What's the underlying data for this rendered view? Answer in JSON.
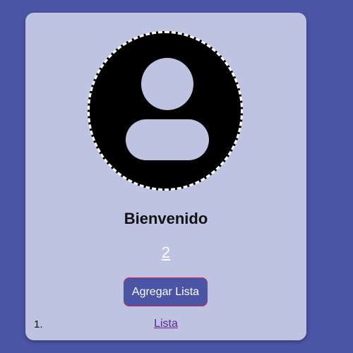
{
  "header": {
    "welcome": "Bienvenido"
  },
  "avatar": {
    "icon": "user-avatar-icon"
  },
  "counter": {
    "value": "2"
  },
  "actions": {
    "add_list_label": "Agregar Lista"
  },
  "lists": [
    {
      "number": "1.",
      "label": "Lista"
    }
  ],
  "colors": {
    "page_background": "#4b55a5",
    "card_background": "#bec3e1",
    "button_border": "#d6224a",
    "link": "#5a2a8a"
  }
}
